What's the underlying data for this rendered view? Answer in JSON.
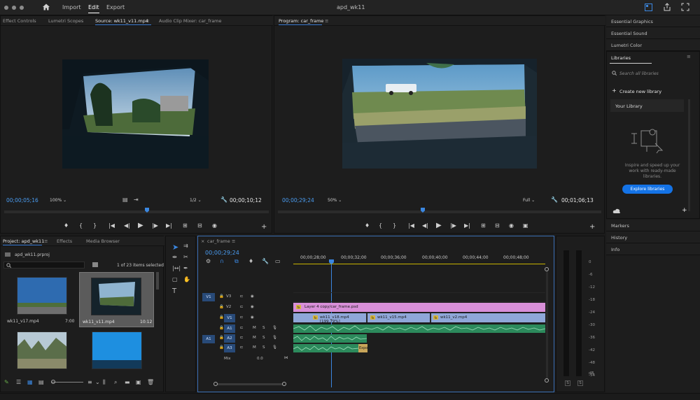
{
  "titlebar": {
    "menus": [
      "Import",
      "Edit",
      "Export"
    ],
    "active_menu": "Edit",
    "project_title": "apd_wk11"
  },
  "source_panel": {
    "tabs": [
      "Effect Controls",
      "Lumetri Scopes",
      "Source: wk11_v11.mp4",
      "Audio Clip Mixer: car_frame"
    ],
    "active_tab": "Source: wk11_v11.mp4",
    "timecode_current": "00;00;05;16",
    "zoom": "100%",
    "resolution": "1/2",
    "timecode_duration": "00;00;10;12"
  },
  "program_panel": {
    "tab": "Program: car_frame",
    "timecode_current": "00;00;29;24",
    "zoom": "50%",
    "resolution": "Full",
    "timecode_duration": "00;01;06;13"
  },
  "right_panels": {
    "items_top": [
      "Essential Graphics",
      "Essential Sound",
      "Lumetri Color"
    ],
    "libraries": {
      "title": "Libraries",
      "search_placeholder": "Search all libraries",
      "create_label": "Create new library",
      "your_library": "Your Library",
      "promo_text_1": "Inspire and speed up your",
      "promo_text_2": "work with ready-made",
      "promo_text_3": "libraries.",
      "explore_button": "Explore libraries"
    },
    "items_bottom": [
      "Markers",
      "History",
      "Info"
    ]
  },
  "project_panel": {
    "tabs": [
      "Project: apd_wk11",
      "Effects",
      "Media Browser"
    ],
    "project_file": "apd_wk11.prproj",
    "selection_info": "1 of 23 items selected",
    "items": [
      {
        "name": "wk11_v17.mp4",
        "duration": "7:00"
      },
      {
        "name": "wk11_v11.mp4",
        "duration": "10:12"
      }
    ]
  },
  "timeline": {
    "tab": "car_frame",
    "timecode": "00;00;29;24",
    "ruler": [
      "00;00;28;00",
      "00;00;32;00",
      "00;00;36;00",
      "00;00;40;00",
      "00;00;44;00",
      "00;00;48;00"
    ],
    "tracks_video": [
      "V3",
      "V2",
      "V1"
    ],
    "tracks_audio": [
      "A1",
      "A2",
      "A3"
    ],
    "mix_label": "Mix",
    "mix_value": "0.0",
    "source_v": "V1",
    "source_a": "A1",
    "clips": {
      "psd": "Layer 4 copy/car_frame.psd",
      "v1_a": "wk11_v18.mp4 [199.79%]",
      "v1_b": "wk11_v15.mp4",
      "v1_c": "wk11_v2.mp4",
      "audio_label": "Expo"
    }
  },
  "audio_meter": {
    "scale": [
      "0",
      "-6",
      "-12",
      "-18",
      "-24",
      "-30",
      "-36",
      "-42",
      "-48",
      "-54",
      "dB"
    ],
    "solo": [
      "S",
      "S"
    ]
  },
  "colors": {
    "accent": "#3b87e0",
    "video_clip": "#8fa7d9",
    "graphic_clip": "#d88fd8",
    "audio_clip": "#2c8a5c"
  }
}
